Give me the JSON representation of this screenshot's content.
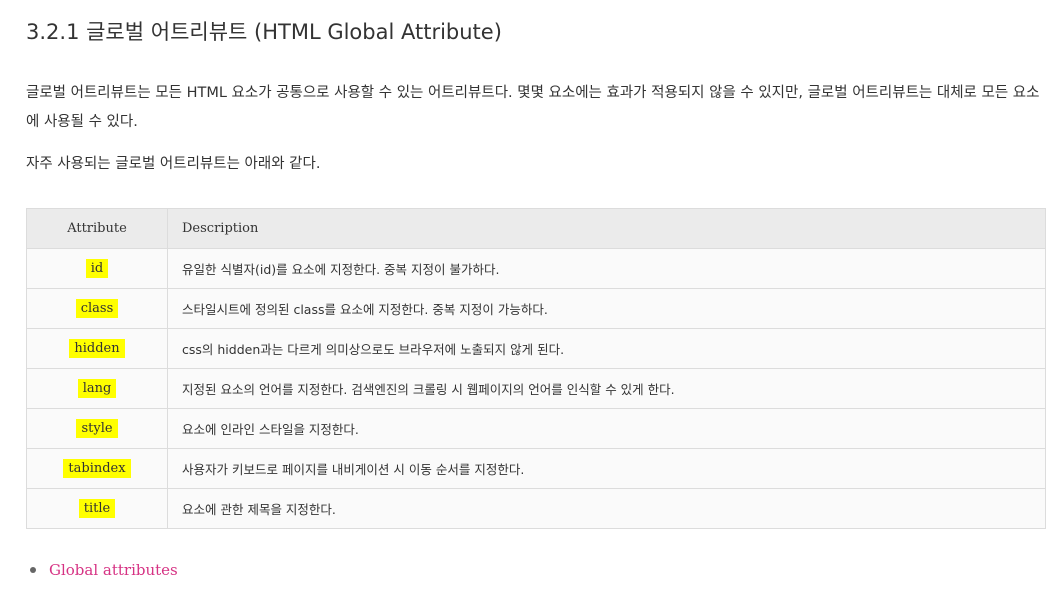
{
  "heading": "3.2.1 글로벌 어트리뷰트 (HTML Global Attribute)",
  "paragraphs": [
    "글로벌 어트리뷰트는 모든 HTML 요소가 공통으로 사용할 수 있는 어트리뷰트다. 몇몇 요소에는 효과가 적용되지 않을 수 있지만, 글로벌 어트리뷰트는 대체로 모든 요소에 사용될 수 있다.",
    "자주 사용되는 글로벌 어트리뷰트는 아래와 같다."
  ],
  "table": {
    "headers": [
      "Attribute",
      "Description"
    ],
    "rows": [
      {
        "attribute": "id",
        "description": "유일한 식별자(id)를 요소에 지정한다. 중복 지정이 불가하다."
      },
      {
        "attribute": "class",
        "description": "스타일시트에 정의된 class를 요소에 지정한다. 중복 지정이 가능하다."
      },
      {
        "attribute": "hidden",
        "description": "css의 hidden과는 다르게 의미상으로도 브라우저에 노출되지 않게 된다."
      },
      {
        "attribute": "lang",
        "description": "지정된 요소의 언어를 지정한다. 검색엔진의 크롤링 시 웹페이지의 언어를 인식할 수 있게 한다."
      },
      {
        "attribute": "style",
        "description": "요소에 인라인 스타일을 지정한다."
      },
      {
        "attribute": "tabindex",
        "description": "사용자가 키보드로 페이지를 내비게이션 시 이동 순서를 지정한다."
      },
      {
        "attribute": "title",
        "description": "요소에 관한 제목을 지정한다."
      }
    ]
  },
  "links": [
    {
      "label": "Global attributes"
    }
  ],
  "colors": {
    "highlight": "#ffff00",
    "link": "#d63384"
  }
}
